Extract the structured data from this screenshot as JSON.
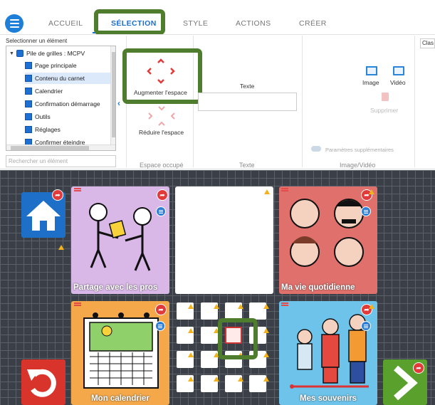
{
  "tabs": [
    {
      "label": "ACCUEIL"
    },
    {
      "label": "SÉLECTION"
    },
    {
      "label": "STYLE"
    },
    {
      "label": "ACTIONS"
    },
    {
      "label": "CRÉER"
    }
  ],
  "ribbon": {
    "tree_label": "Selectionner un élément",
    "tree": [
      {
        "label": "Pile de grilles : MCPV"
      },
      {
        "label": "Page principale"
      },
      {
        "label": "Contenu du carnet"
      },
      {
        "label": "Calendrier"
      },
      {
        "label": "Confirmation démarrage"
      },
      {
        "label": "Outils"
      },
      {
        "label": "Réglages"
      },
      {
        "label": "Confirmer éteindre"
      }
    ],
    "search_placeholder": "Rechercher un élément",
    "augmenter": "Augmenter l'espace",
    "reduire": "Réduire l'espace",
    "espace_group": "Espace occupé",
    "texte_label": "Texte",
    "texte_group": "Texte",
    "image": "Image",
    "video": "Vidéo",
    "supprimer": "Supprimer",
    "params": "Paramètres supplémentaires",
    "image_group": "Image/Vidéo",
    "clas": "Clas"
  },
  "cards": {
    "partage": "Partage avec les pros",
    "vie": "Ma vie quotidienne",
    "calendrier": "Mon calendrier",
    "souvenirs": "Mes souvenirs"
  },
  "colors": {
    "accent": "#1b6fd1",
    "highlight": "#4f7d2e",
    "purple": "#d9b8e8",
    "red": "#e0706b",
    "orange": "#f4a84a",
    "blue": "#6ec3ea"
  }
}
